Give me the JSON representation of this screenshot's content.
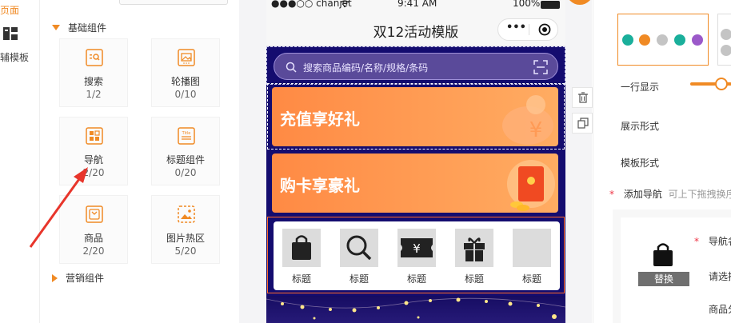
{
  "left_nav": {
    "active_label": "微页面",
    "template_label": "辅模板"
  },
  "components": {
    "basic_group_title": "基础组件",
    "marketing_group_title": "营销组件",
    "items": [
      {
        "name": "搜索",
        "count": "1/2"
      },
      {
        "name": "轮播图",
        "count": "0/10"
      },
      {
        "name": "导航",
        "count": "2/20"
      },
      {
        "name": "标题组件",
        "count": "0/20"
      },
      {
        "name": "商品",
        "count": "2/20"
      },
      {
        "name": "图片热区",
        "count": "5/20"
      }
    ],
    "title_icon_text": "Title"
  },
  "phone": {
    "status": {
      "carrier": "●●●○○ chanjet",
      "time": "9:41 AM",
      "battery": "100%"
    },
    "title": "双12活动模版",
    "capsule_more": "•••",
    "search_placeholder": "搜索商品编码/名称/规格/条码",
    "banners": [
      {
        "text": "充值享好礼"
      },
      {
        "text": "购卡享豪礼"
      }
    ],
    "nav_items": [
      {
        "label": "标题",
        "icon": "shopping-bag-icon"
      },
      {
        "label": "标题",
        "icon": "magnifier-icon"
      },
      {
        "label": "标题",
        "icon": "yen-ticket-icon"
      },
      {
        "label": "标题",
        "icon": "gift-icon"
      },
      {
        "label": "标题",
        "icon": "blank-image"
      }
    ],
    "yen_symbol": "¥"
  },
  "right_panel": {
    "theme_colors": [
      "#1aaf9b",
      "#f08a24",
      "#c4c4c4",
      "#1aaf9b",
      "#9b59c9"
    ],
    "per_row_label": "一行显示",
    "display_style_label": "展示形式",
    "template_style_label": "模板形式",
    "add_nav_label": "添加导航",
    "add_nav_hint": "可上下拖拽换序",
    "replace_button": "替换",
    "nav_name_label": "导航名称",
    "select_label": "请选择跳",
    "category_label": "商品分"
  },
  "colors": {
    "accent": "#f08a24",
    "phone_bg": "#140c6f",
    "selection": "#ff6a2a"
  }
}
